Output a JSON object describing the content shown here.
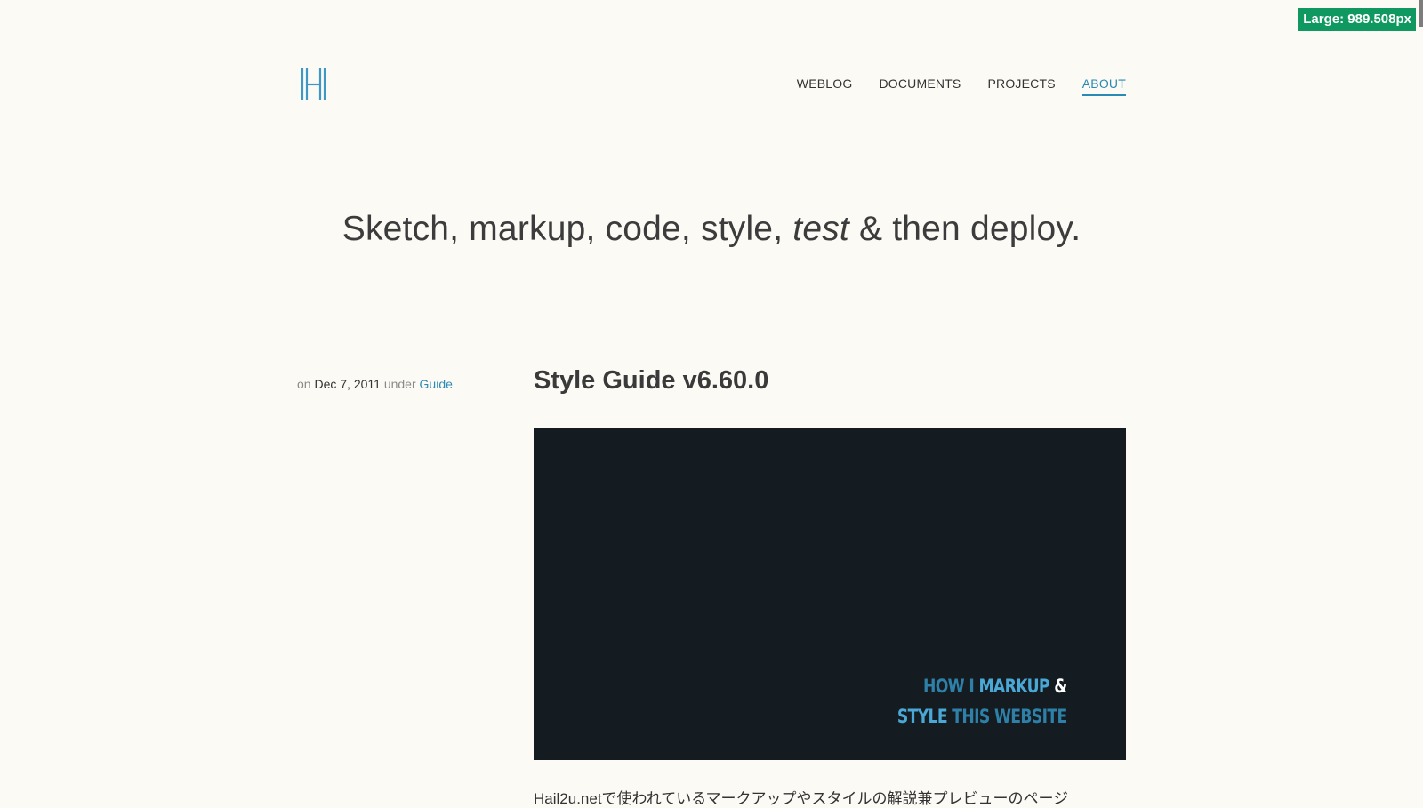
{
  "viewport_badge": "Large: 989.508px",
  "header": {
    "logo_icon": "h-monogram-icon",
    "nav": [
      {
        "label": "WEBLOG",
        "active": false
      },
      {
        "label": "DOCUMENTS",
        "active": false
      },
      {
        "label": "PROJECTS",
        "active": false
      },
      {
        "label": "ABOUT",
        "active": true
      }
    ]
  },
  "tagline": {
    "part1": "Sketch, markup, code, style, ",
    "emphasis": "test",
    "part2": " & then deploy."
  },
  "post": {
    "meta_on": "on",
    "date": "Dec 7, 2011",
    "meta_under": "under",
    "category": "Guide",
    "title": "Style Guide v6.60.0",
    "hero": {
      "line1": [
        "HOW I",
        "MARKUP",
        "&"
      ],
      "line2": [
        "STYLE",
        "THIS WEBSITE"
      ]
    },
    "intro": "Hail2u.netで使われているマークアップやスタイルの解説兼プレビューのページ"
  },
  "colors": {
    "background": "#fcfaf4",
    "accent": "#2b8ab5",
    "hero_background": "#141c22",
    "badge": "#0f9960"
  }
}
